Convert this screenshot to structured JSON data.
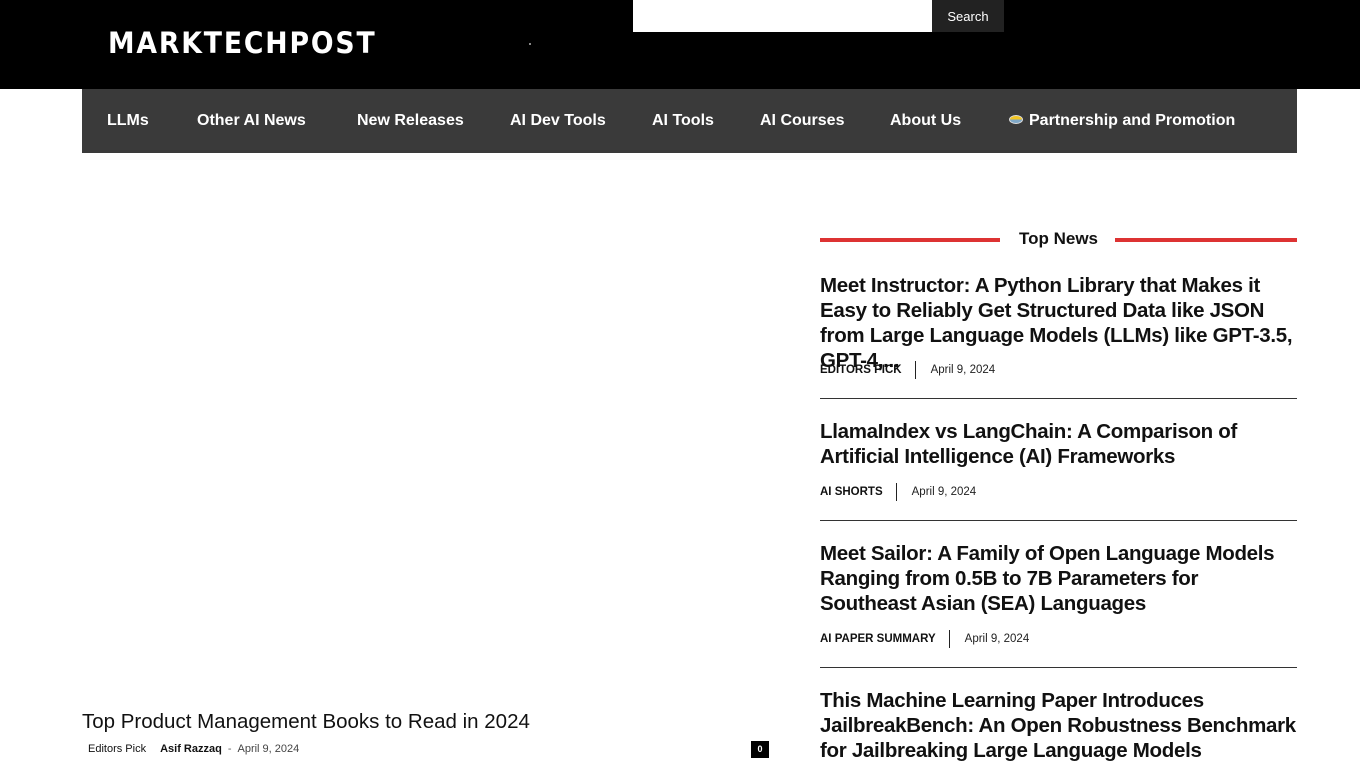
{
  "header": {
    "logo_text": "MARKTECHPOST",
    "search": {
      "placeholder": "",
      "button_label": "Search"
    }
  },
  "nav": {
    "items": [
      {
        "label": "LLMs"
      },
      {
        "label": "Other AI News"
      },
      {
        "label": "New Releases"
      },
      {
        "label": "AI Dev Tools"
      },
      {
        "label": "AI Tools"
      },
      {
        "label": "AI Courses"
      },
      {
        "label": "About Us"
      },
      {
        "label": "Partnership and Promotion",
        "icon": "flag-icon"
      }
    ]
  },
  "feature": {
    "title": "Top Product Management Books to Read in 2024",
    "category": "Editors Pick",
    "author": "Asif Razzaq",
    "separator": "-",
    "date": "April 9, 2024",
    "comments": "0"
  },
  "top_news": {
    "heading": "Top News",
    "accent_color": "#dd3333",
    "items": [
      {
        "title": "Meet Instructor: A Python Library that Makes it Easy to Reliably Get Structured Data like JSON from Large Language Models (LLMs) like GPT-3.5, GPT-4,...",
        "category": "Editors Pick",
        "date": "April 9, 2024"
      },
      {
        "title": "LlamaIndex vs LangChain: A Comparison of Artificial Intelligence (AI) Frameworks",
        "category": "AI Shorts",
        "date": "April 9, 2024"
      },
      {
        "title": "Meet Sailor: A Family of Open Language Models Ranging from 0.5B to 7B Parameters for Southeast Asian (SEA) Languages",
        "category": "AI Paper Summary",
        "date": "April 9, 2024"
      },
      {
        "title": "This Machine Learning Paper Introduces JailbreakBench: An Open Robustness Benchmark for Jailbreaking Large Language Models",
        "category": "",
        "date": ""
      }
    ]
  }
}
